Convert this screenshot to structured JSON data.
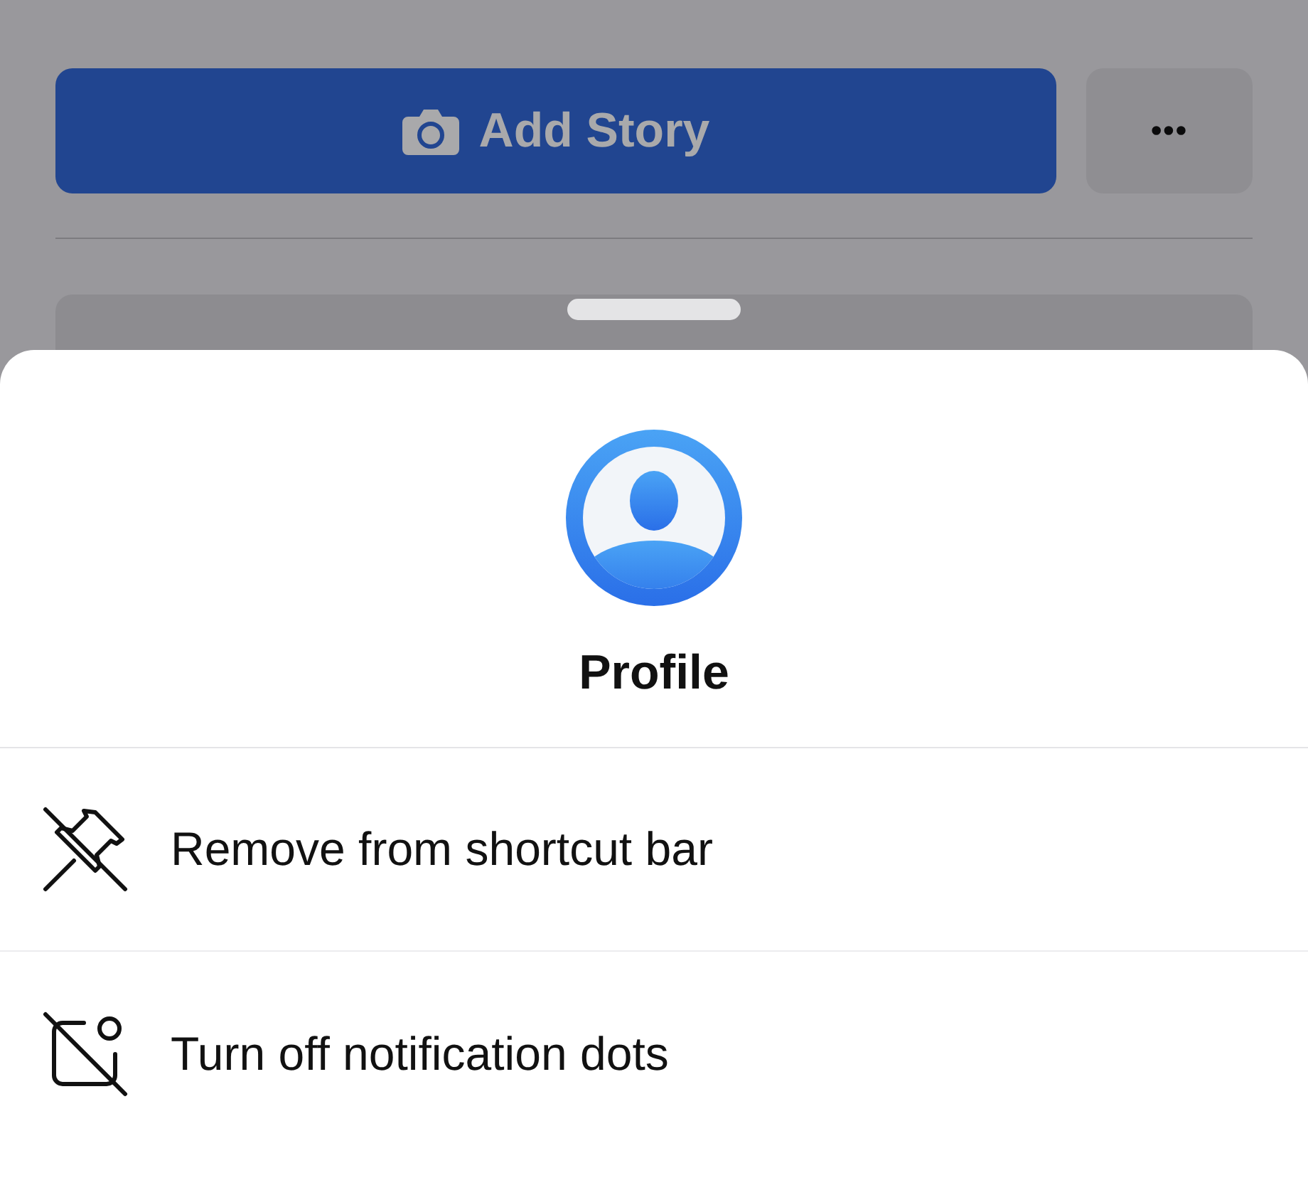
{
  "background": {
    "add_story_button": {
      "label": "Add Story"
    },
    "more_button": {
      "label": "•••"
    }
  },
  "sheet": {
    "title": "Profile",
    "items": [
      {
        "kind": "unpin",
        "label": "Remove from shortcut bar"
      },
      {
        "kind": "dots-off",
        "label": "Turn off notification dots"
      }
    ]
  }
}
